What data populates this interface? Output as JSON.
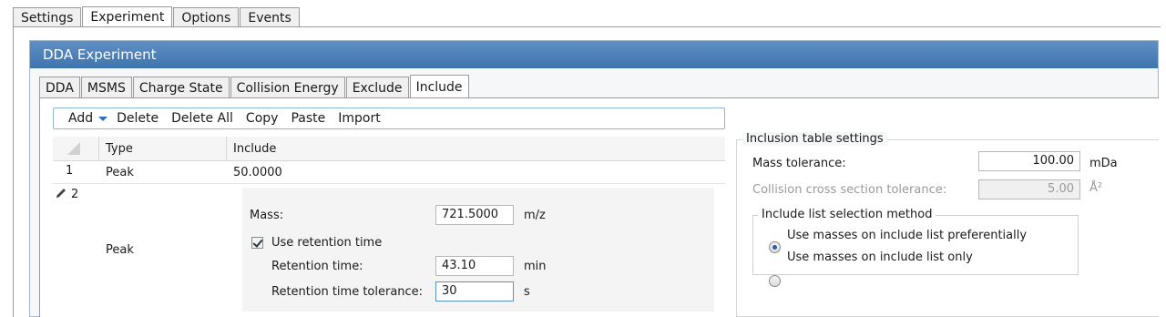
{
  "top_tabs": [
    "Settings",
    "Experiment",
    "Options",
    "Events"
  ],
  "panel": {
    "title": "DDA Experiment"
  },
  "inner_tabs": [
    "DDA",
    "MSMS",
    "Charge State",
    "Collision Energy",
    "Exclude",
    "Include"
  ],
  "toolbar": {
    "add": "Add",
    "delete": "Delete",
    "delete_all": "Delete All",
    "copy": "Copy",
    "paste": "Paste",
    "import": "Import"
  },
  "grid": {
    "headers": {
      "type": "Type",
      "include": "Include"
    },
    "rows": [
      {
        "num": "1",
        "type": "Peak",
        "include": "50.0000"
      },
      {
        "num": "2",
        "type": "Peak"
      }
    ],
    "detail": {
      "mass_label": "Mass:",
      "mass_value": "721.5000",
      "mass_unit": "m/z",
      "use_rt_label": "Use retention time",
      "rt_label": "Retention time:",
      "rt_value": "43.10",
      "rt_unit": "min",
      "rt_tol_label": "Retention time tolerance:",
      "rt_tol_value": "30",
      "rt_tol_unit": "s"
    }
  },
  "inclusion_settings": {
    "title": "Inclusion table settings",
    "mass_tol_label": "Mass tolerance:",
    "mass_tol_value": "100.00",
    "mass_tol_unit": "mDa",
    "ccs_tol_label": "Collision cross section tolerance:",
    "ccs_tol_value": "5.00",
    "ccs_tol_unit": "Å²",
    "method_title": "Include list selection method",
    "option_preferential": "Use masses on include list preferentially",
    "option_only": "Use masses on include list only"
  },
  "colors": {
    "header_blue": "#4a7fb9",
    "accent": "#2a5fa8"
  }
}
